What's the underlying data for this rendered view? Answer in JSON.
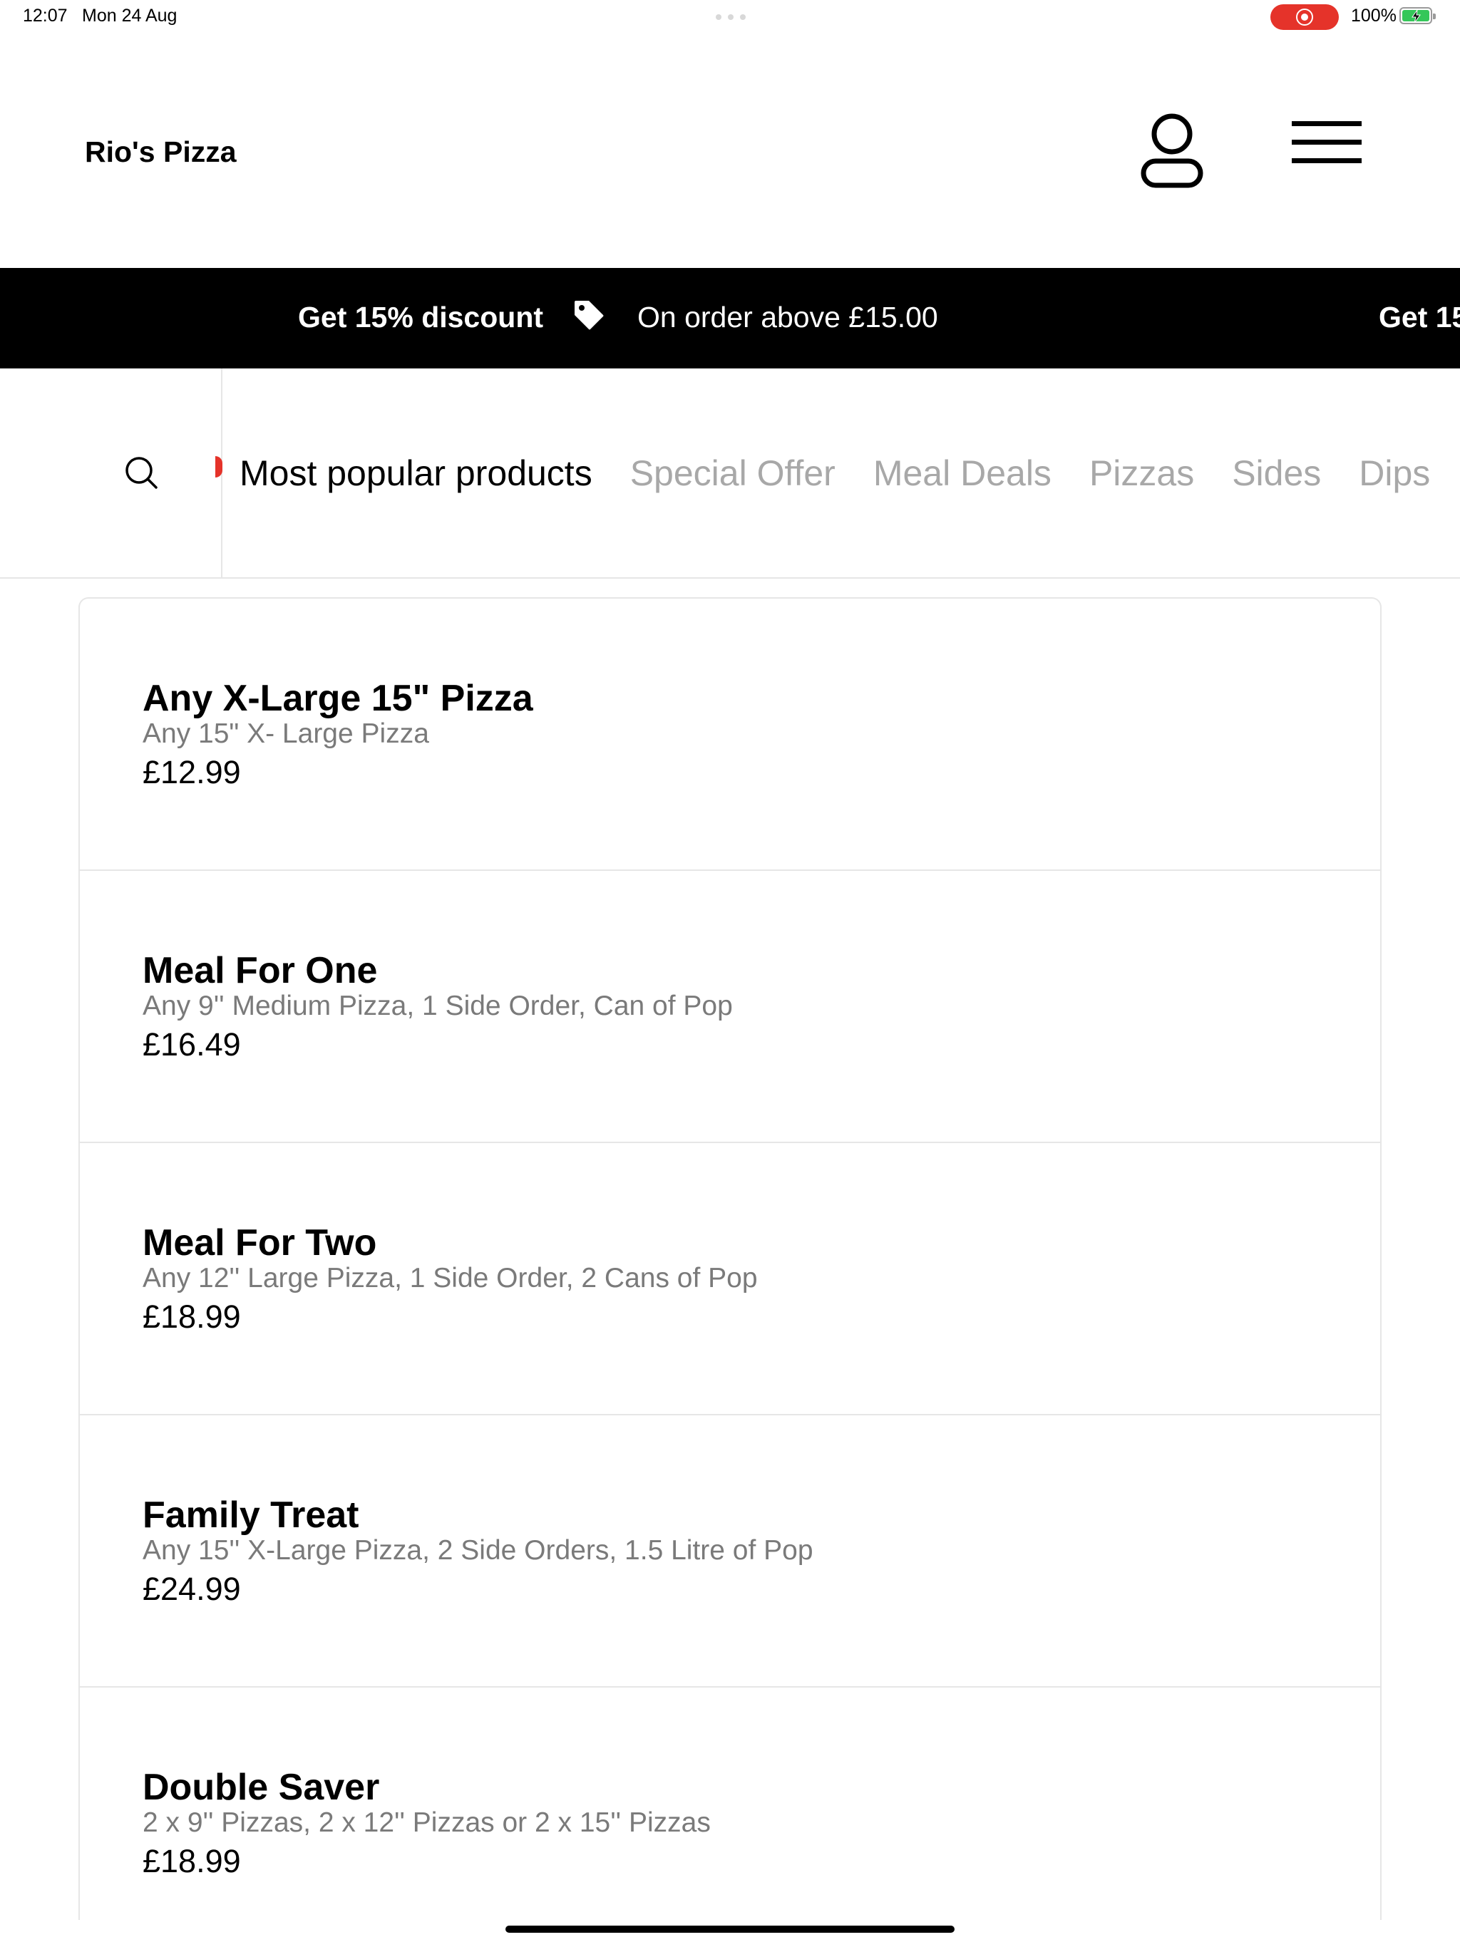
{
  "status_bar": {
    "time": "12:07",
    "date": "Mon 24 Aug",
    "battery": "100%",
    "record_color": "#e5332a",
    "battery_color": "#34c759"
  },
  "header": {
    "brand": "Rio's Pizza",
    "account_icon": "person-icon",
    "menu_icon": "hamburger-menu-icon"
  },
  "promo": {
    "title": "Get 15% discount",
    "text": "On order above £15.00",
    "title_repeat": "Get 15",
    "icon": "tag-icon"
  },
  "nav": {
    "search_icon": "search-icon",
    "tabs": [
      {
        "label": "Most popular products",
        "active": true
      },
      {
        "label": "Special Offer",
        "active": false
      },
      {
        "label": "Meal Deals",
        "active": false
      },
      {
        "label": "Pizzas",
        "active": false
      },
      {
        "label": "Sides",
        "active": false
      },
      {
        "label": "Dips",
        "active": false
      }
    ]
  },
  "products": [
    {
      "name": "Any X-Large 15\" Pizza",
      "desc": "Any 15\" X- Large Pizza",
      "price": "£12.99"
    },
    {
      "name": "Meal For One",
      "desc": "Any 9'' Medium Pizza, 1 Side Order, Can of Pop",
      "price": "£16.49"
    },
    {
      "name": "Meal For Two",
      "desc": "Any 12'' Large Pizza, 1 Side Order, 2 Cans of Pop",
      "price": "£18.99"
    },
    {
      "name": "Family Treat",
      "desc": "Any 15'' X-Large Pizza, 2 Side Orders, 1.5 Litre of Pop",
      "price": "£24.99"
    },
    {
      "name": "Double Saver",
      "desc": "2 x 9'' Pizzas, 2 x 12'' Pizzas or 2 x 15'' Pizzas",
      "price": "£18.99"
    }
  ]
}
